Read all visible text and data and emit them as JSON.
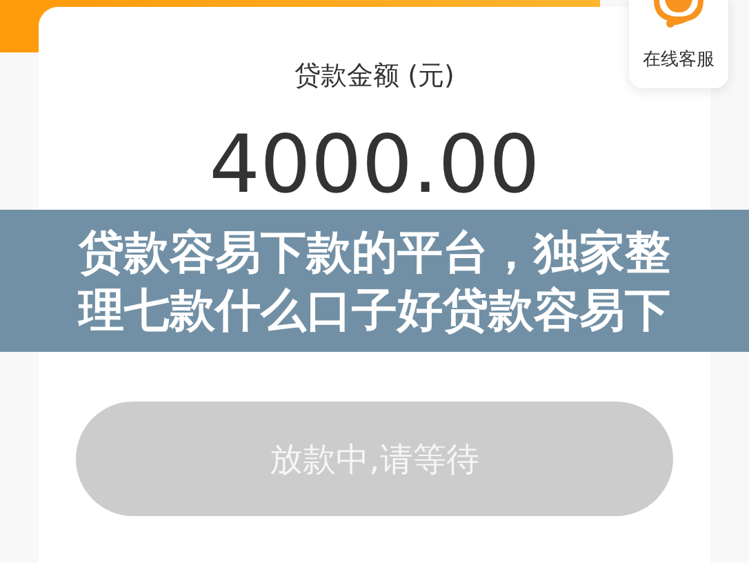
{
  "amount_label": "贷款金额 (元)",
  "amount": "4000.00",
  "service": {
    "label": "在线客服"
  },
  "status_button": {
    "label": "放款中,请等待",
    "disabled": true
  },
  "overlay_title": {
    "lines": [
      "贷款容易下款的平台，独家整",
      "理七款什么口子好贷款容易下"
    ]
  }
}
